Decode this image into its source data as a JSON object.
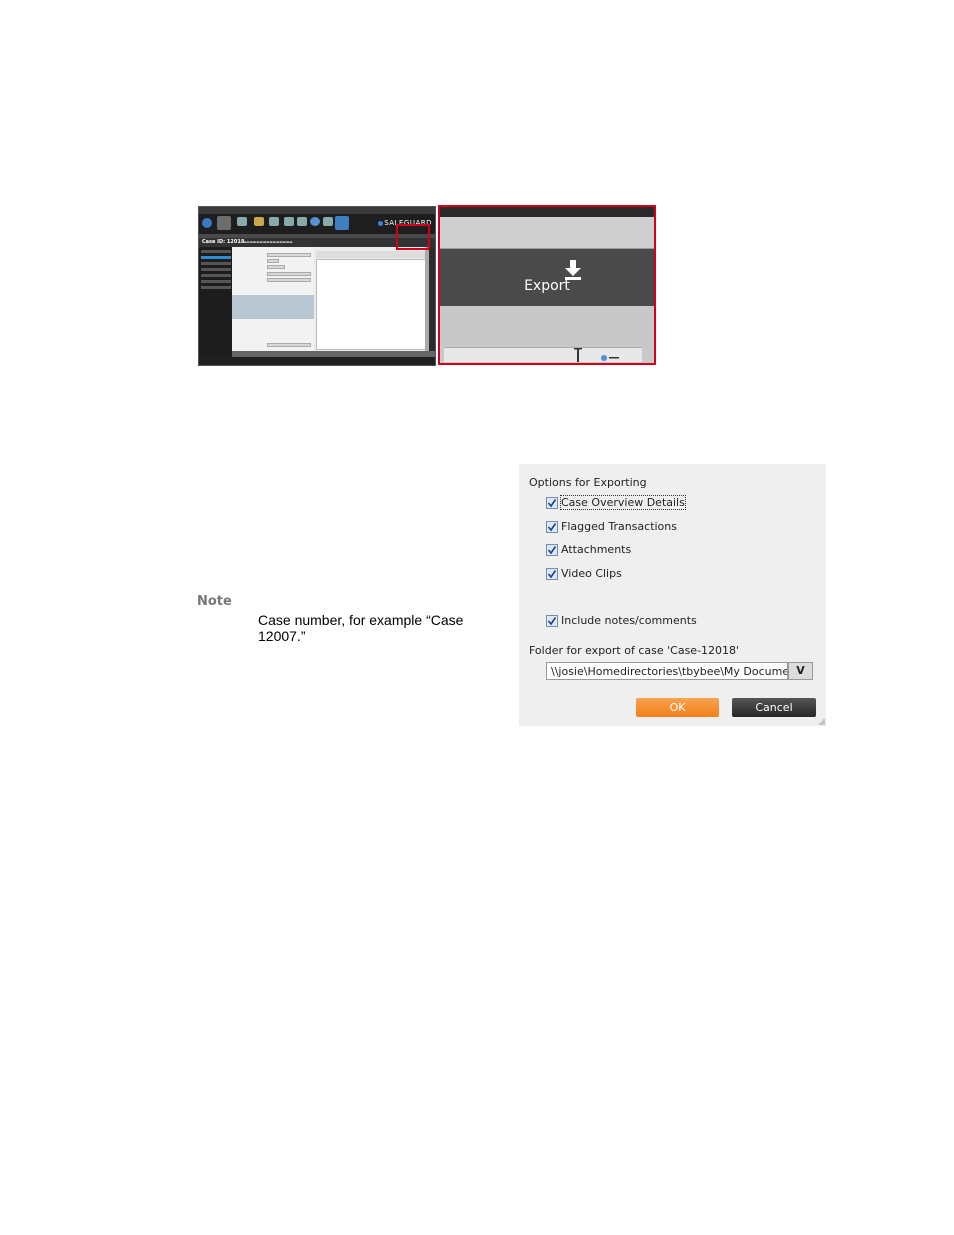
{
  "app_screenshot": {
    "brand": "SALEGUARD",
    "case_id_label": "Case ID: 12018"
  },
  "zoom_panel": {
    "export_label": "Export"
  },
  "note": {
    "label": "Note",
    "text": "Case number, for example “Case 12007.”"
  },
  "export_dialog": {
    "title": "Options for Exporting",
    "options": [
      {
        "label": "Case Overview Details",
        "checked": true
      },
      {
        "label": "Flagged Transactions",
        "checked": true
      },
      {
        "label": "Attachments",
        "checked": true
      },
      {
        "label": "Video Clips",
        "checked": true
      },
      {
        "label": "Include notes/comments",
        "checked": true
      }
    ],
    "folder_label": "Folder for export of case 'Case-12018'",
    "folder_path": "\\\\josie\\Homedirectories\\tbybee\\My Documents",
    "browse_label": "V",
    "ok_label": "OK",
    "cancel_label": "Cancel"
  }
}
